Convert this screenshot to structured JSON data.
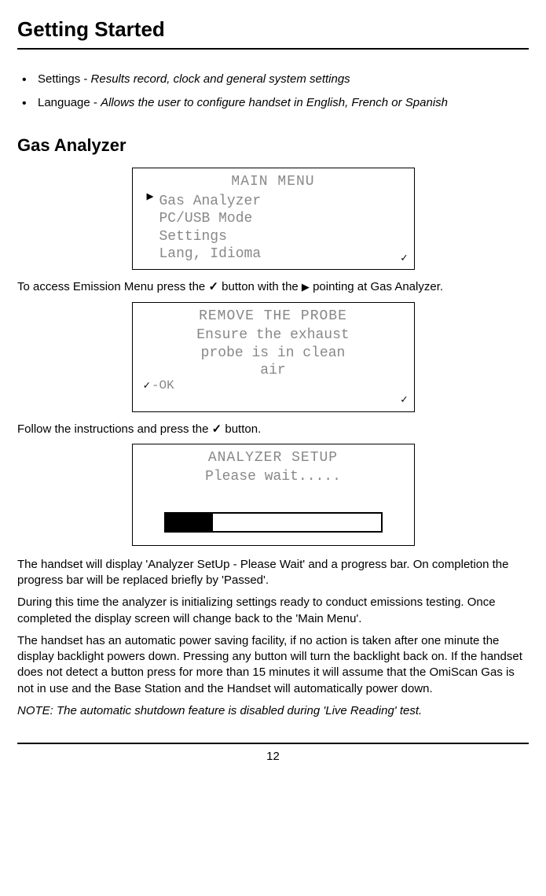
{
  "page": {
    "title": "Getting Started",
    "number": "12"
  },
  "bullets": {
    "item1_label": "Settings - ",
    "item1_desc": "Results record, clock and general system settings",
    "item2_label": "Language - ",
    "item2_desc": "Allows the user to configure handset in English, French or Spanish"
  },
  "section": {
    "heading": "Gas Analyzer"
  },
  "lcd1": {
    "title": "MAIN MENU",
    "row1": "Gas Analyzer",
    "row2": "PC/USB Mode",
    "row3": "Settings",
    "row4": "Lang, Idioma"
  },
  "para1_a": "To access Emission Menu press the ",
  "para1_b": " button with the ",
  "para1_c": " pointing at Gas Analyzer.",
  "lcd2": {
    "title": "REMOVE THE PROBE",
    "row1": "Ensure the exhaust",
    "row2": "probe is in clean",
    "row3": "air",
    "ok": "-OK"
  },
  "para2_a": "Follow the instructions and press the ",
  "para2_b": " button.",
  "lcd3": {
    "title": "ANALYZER SETUP",
    "row1": "Please wait....."
  },
  "body_p1": "The handset will display 'Analyzer SetUp - Please Wait' and a progress bar. On completion the progress bar will be replaced briefly by 'Passed'.",
  "body_p2": "During this time the analyzer is initializing settings ready to conduct emissions testing. Once completed the display screen will change back to the 'Main Menu'.",
  "body_p3": "The handset has an automatic power saving facility, if no action is taken after one minute the display backlight powers down. Pressing any button will turn the backlight back on. If the handset does not detect a button press for more than 15 minutes it will assume that the OmiScan Gas is not in use and the Base Station and the Handset will automatically power down.",
  "body_note": "NOTE: The automatic shutdown feature is disabled during 'Live Reading' test."
}
